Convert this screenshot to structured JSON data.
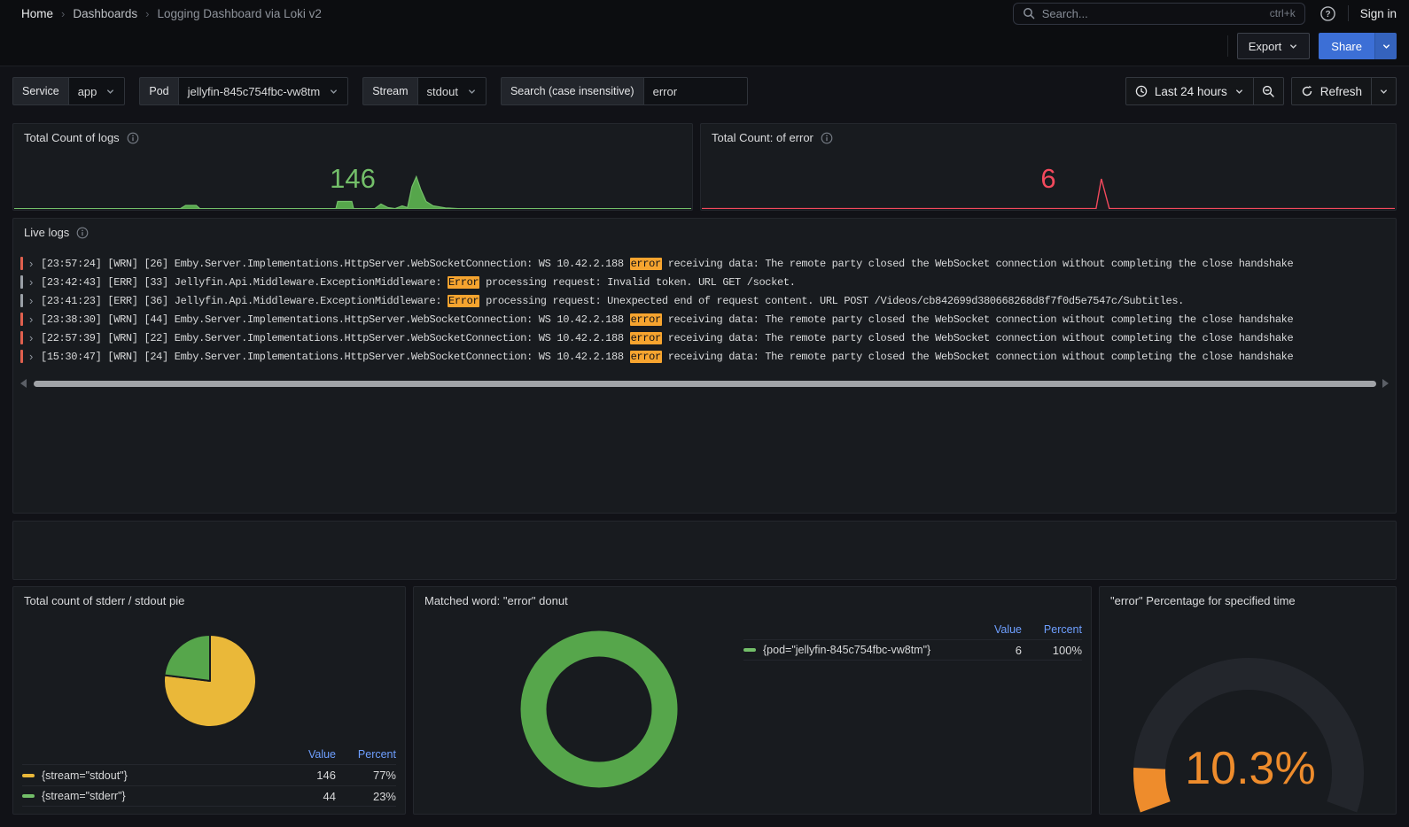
{
  "colors": {
    "green": "#73bf69",
    "pie_green": "#56a64b",
    "yellow": "#eab839",
    "red": "#f2495c",
    "orange": "#ee8c2c",
    "highlight": "#f6a42f",
    "bar_red": "#e0604e",
    "bar_gray": "#9aa0a7",
    "header_blue": "#6e9fff",
    "gauge_track": "#23262c"
  },
  "nav": {
    "breadcrumb": [
      "Home",
      "Dashboards",
      "Logging Dashboard via Loki v2"
    ],
    "search_placeholder": "Search...",
    "search_shortcut": "ctrl+k",
    "sign_in_label": "Sign in"
  },
  "toolbar": {
    "export_label": "Export",
    "share_label": "Share"
  },
  "filters": {
    "service": {
      "label": "Service",
      "value": "app"
    },
    "pod": {
      "label": "Pod",
      "value": "jellyfin-845c754fbc-vw8tm"
    },
    "stream": {
      "label": "Stream",
      "value": "stdout"
    },
    "search": {
      "label": "Search (case insensitive)",
      "value": "error"
    }
  },
  "time_picker": {
    "range": "Last 24 hours",
    "refresh_label": "Refresh"
  },
  "stat_logs": {
    "title": "Total Count of logs",
    "value": "146"
  },
  "stat_errors": {
    "title": "Total Count: of error",
    "value": "6"
  },
  "live_logs": {
    "title": "Live logs",
    "rows": [
      {
        "bar_color": "#e0604e",
        "segments": [
          {
            "text": "[23:57:24] [WRN] [26] Emby.Server.Implementations.HttpServer.WebSocketConnection: WS 10.42.2.188 "
          },
          {
            "text": "error",
            "highlight": true
          },
          {
            "text": " receiving data: The remote party closed the WebSocket connection without completing the close handshake"
          }
        ]
      },
      {
        "bar_color": "#9aa0a7",
        "segments": [
          {
            "text": "[23:42:43] [ERR] [33] Jellyfin.Api.Middleware.ExceptionMiddleware: "
          },
          {
            "text": "Error",
            "highlight": true
          },
          {
            "text": " processing request: Invalid token. URL GET /socket."
          }
        ]
      },
      {
        "bar_color": "#9aa0a7",
        "segments": [
          {
            "text": "[23:41:23] [ERR] [36] Jellyfin.Api.Middleware.ExceptionMiddleware: "
          },
          {
            "text": "Error",
            "highlight": true
          },
          {
            "text": " processing request: Unexpected end of request content. URL POST /Videos/cb842699d380668268d8f7f0d5e7547c/Subtitles."
          }
        ]
      },
      {
        "bar_color": "#e0604e",
        "segments": [
          {
            "text": "[23:38:30] [WRN] [44] Emby.Server.Implementations.HttpServer.WebSocketConnection: WS 10.42.2.188 "
          },
          {
            "text": "error",
            "highlight": true
          },
          {
            "text": " receiving data: The remote party closed the WebSocket connection without completing the close handshake"
          }
        ]
      },
      {
        "bar_color": "#e0604e",
        "segments": [
          {
            "text": "[22:57:39] [WRN] [22] Emby.Server.Implementations.HttpServer.WebSocketConnection: WS 10.42.2.188 "
          },
          {
            "text": "error",
            "highlight": true
          },
          {
            "text": " receiving data: The remote party closed the WebSocket connection without completing the close handshake"
          }
        ]
      },
      {
        "bar_color": "#e0604e",
        "segments": [
          {
            "text": "[15:30:47] [WRN] [24] Emby.Server.Implementations.HttpServer.WebSocketConnection: WS 10.42.2.188 "
          },
          {
            "text": "error",
            "highlight": true
          },
          {
            "text": " receiving data: The remote party closed the WebSocket connection without completing the close handshake"
          }
        ]
      }
    ]
  },
  "pie_panel": {
    "title": "Total count of stderr / stdout pie",
    "legend": {
      "value_header": "Value",
      "percent_header": "Percent",
      "rows": [
        {
          "label": "{stream=\"stdout\"}",
          "value": "146",
          "percent": "77%",
          "color": "#eab839"
        },
        {
          "label": "{stream=\"stderr\"}",
          "value": "44",
          "percent": "23%",
          "color": "#73bf69"
        }
      ]
    }
  },
  "donut_panel": {
    "title": "Matched word: \"error\" donut",
    "legend": {
      "value_header": "Value",
      "percent_header": "Percent",
      "rows": [
        {
          "label": "{pod=\"jellyfin-845c754fbc-vw8tm\"}",
          "value": "6",
          "percent": "100%",
          "color": "#73bf69"
        }
      ]
    }
  },
  "gauge_panel": {
    "title": "\"error\" Percentage for specified time",
    "value": "10.3%"
  },
  "chart_data": [
    {
      "type": "stat",
      "title": "Total Count of logs",
      "value": 146,
      "color": "#73bf69",
      "sparkline": true
    },
    {
      "type": "stat",
      "title": "Total Count: of error",
      "value": 6,
      "color": "#f2495c",
      "sparkline": true
    },
    {
      "type": "pie",
      "title": "Total count of stderr / stdout pie",
      "labels": [
        "{stream=\"stdout\"}",
        "{stream=\"stderr\"}"
      ],
      "values": [
        146,
        44
      ],
      "percents": [
        77,
        23
      ],
      "colors": [
        "#eab839",
        "#56a64b"
      ],
      "legend_position": "bottom"
    },
    {
      "type": "pie",
      "subtype": "donut",
      "title": "Matched word: \"error\" donut",
      "labels": [
        "{pod=\"jellyfin-845c754fbc-vw8tm\"}"
      ],
      "values": [
        6
      ],
      "percents": [
        100
      ],
      "colors": [
        "#73bf69"
      ],
      "legend_position": "right"
    },
    {
      "type": "gauge",
      "title": "\"error\" Percentage for specified time",
      "value": 10.3,
      "unit": "%",
      "range": [
        0,
        100
      ],
      "color": "#ee8c2c"
    }
  ]
}
